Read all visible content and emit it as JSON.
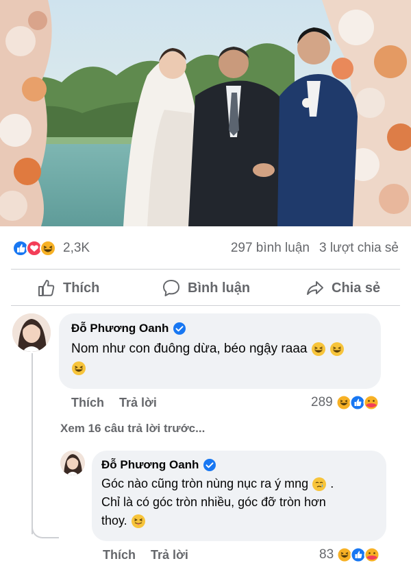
{
  "post": {
    "reactions": {
      "count": "2,3K",
      "types": [
        "like-icon",
        "love-icon",
        "haha-icon"
      ]
    },
    "comment_count": "297 bình luận",
    "share_count": "3 lượt chia sẻ"
  },
  "actions": {
    "like": "Thích",
    "comment": "Bình luận",
    "share": "Chia sẻ"
  },
  "comments": [
    {
      "author": "Đỗ Phương Oanh",
      "verified": true,
      "text_line1": "Nom như con đuông dừa, béo ngậy raaa",
      "like_label": "Thích",
      "reply_label": "Trả lời",
      "reaction_count": "289"
    }
  ],
  "see_more_replies": "Xem 16 câu trả lời trước...",
  "replies": [
    {
      "author": "Đỗ Phương Oanh",
      "verified": true,
      "line1": "Góc nào cũng tròn nùng nục ra ý mng",
      "line2": "Chỉ là có góc tròn nhiều, góc đỡ tròn hơn",
      "line3": "thoy.",
      "like_label": "Thích",
      "reply_label": "Trả lời",
      "reaction_count": "83"
    }
  ],
  "colors": {
    "secondary_text": "#65676b",
    "bubble": "#f0f2f5",
    "verified": "#1877f2",
    "like_blue": "#1877f2",
    "love_red": "#f33e58",
    "haha_yellow": "#f7b125"
  }
}
